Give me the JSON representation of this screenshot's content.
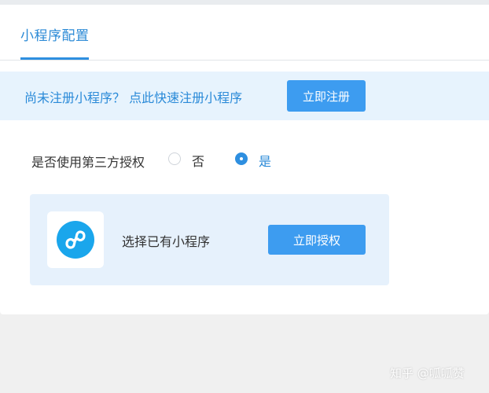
{
  "tabs": {
    "active_label": "小程序配置"
  },
  "notice": {
    "text": "尚未注册小程序？ 点此快速注册小程序",
    "register_button": "立即注册"
  },
  "authorization": {
    "label": "是否使用第三方授权",
    "option_no": "否",
    "option_yes": "是",
    "selected": "是"
  },
  "program": {
    "icon": "mini-program-icon",
    "text": "选择已有小程序",
    "authorize_button": "立即授权"
  },
  "watermark": {
    "text": "知乎 @呱呱赞"
  },
  "colors": {
    "accent": "#2e8fe0",
    "button": "#3d9cf0",
    "notice_bg": "#e7f3fd",
    "program_bg": "#e6f1fc"
  }
}
